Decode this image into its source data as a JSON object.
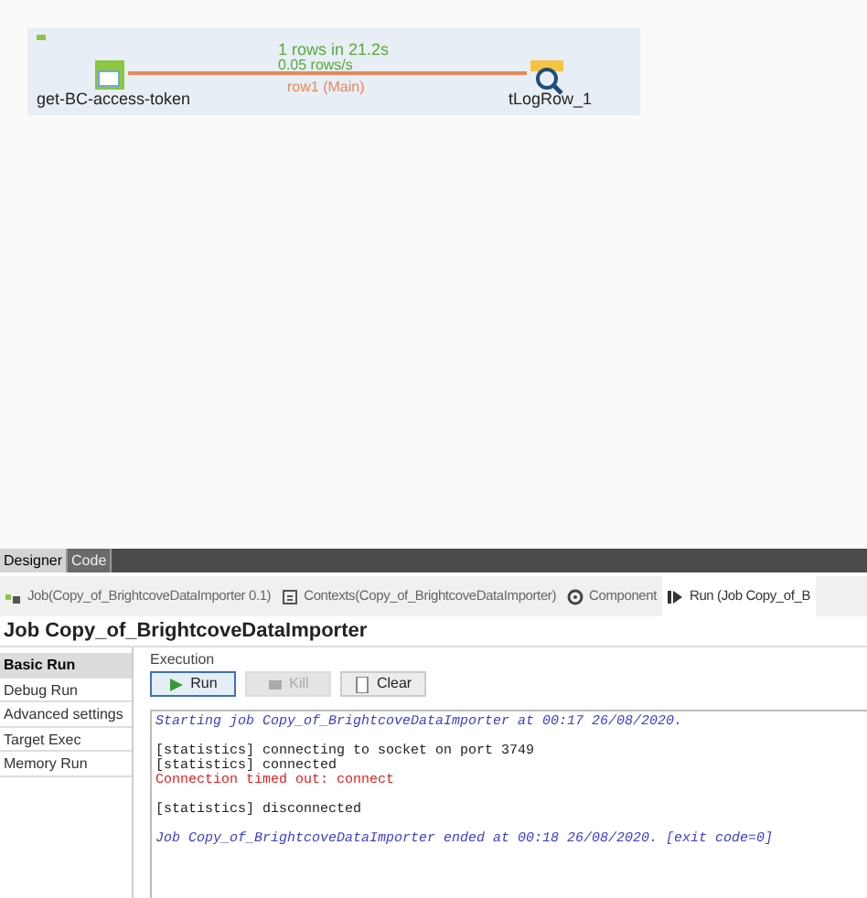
{
  "canvas": {
    "nodes": [
      {
        "label": "get-BC-access-token",
        "kind": "input"
      },
      {
        "label": "tLogRow_1",
        "kind": "log"
      }
    ],
    "link": {
      "stats": "1 rows in 21.2s",
      "rate": "0.05 rows/s",
      "label": "row1 (Main)"
    }
  },
  "editor_tabs": [
    {
      "label": "Designer",
      "selected": true
    },
    {
      "label": "Code",
      "selected": false
    }
  ],
  "view_tabs": [
    {
      "label": "Job(Copy_of_BrightcoveDataImporter 0.1)",
      "kind": "job",
      "selected": false
    },
    {
      "label": "Contexts(Copy_of_BrightcoveDataImporter)",
      "kind": "contexts",
      "selected": false
    },
    {
      "label": "Component",
      "kind": "component",
      "selected": false
    },
    {
      "label": "Run (Job Copy_of_B",
      "kind": "run",
      "selected": true
    }
  ],
  "job_title": "Job Copy_of_BrightcoveDataImporter",
  "sidebar": [
    {
      "label": "Basic Run",
      "selected": true
    },
    {
      "label": "Debug Run",
      "selected": false
    },
    {
      "label": "Advanced settings",
      "selected": false
    },
    {
      "label": "Target Exec",
      "selected": false
    },
    {
      "label": "Memory Run",
      "selected": false
    }
  ],
  "execution": {
    "title": "Execution",
    "buttons": [
      {
        "label": "Run",
        "kind": "run",
        "disabled": false
      },
      {
        "label": "Kill",
        "kind": "kill",
        "disabled": true
      },
      {
        "label": "Clear",
        "kind": "clear",
        "disabled": false
      }
    ]
  },
  "console": [
    {
      "kind": "info",
      "text": "Starting job Copy_of_BrightcoveDataImporter at 00:17 26/08/2020."
    },
    {
      "kind": "blank"
    },
    {
      "kind": "stat",
      "text": "[statistics] connecting to socket on port 3749"
    },
    {
      "kind": "stat",
      "text": "[statistics] connected"
    },
    {
      "kind": "error",
      "text": "Connection timed out: connect"
    },
    {
      "kind": "blank"
    },
    {
      "kind": "stat",
      "text": "[statistics] disconnected"
    },
    {
      "kind": "blank"
    },
    {
      "kind": "info",
      "text": "Job Copy_of_BrightcoveDataImporter ended at 00:18 26/08/2020. [exit code=0]"
    }
  ]
}
